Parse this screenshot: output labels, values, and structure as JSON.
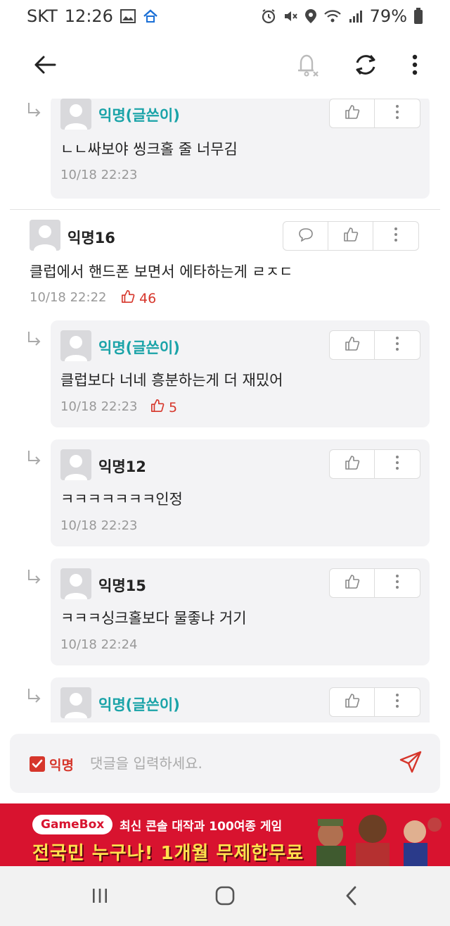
{
  "status_bar": {
    "carrier": "SKT",
    "time": "12:26",
    "battery": "79%"
  },
  "comments": [
    {
      "kind": "reply",
      "author": "익명(글쓴이)",
      "is_op": true,
      "text": "ㄴㄴ싸보야 씽크홀 줄 너무김",
      "time": "10/18 22:23",
      "likes": null
    },
    {
      "kind": "comment",
      "author": "익명16",
      "is_op": false,
      "text": "클럽에서 핸드폰 보면서 에타하는게 ㄹㅈㄷ",
      "time": "10/18 22:22",
      "likes": "46"
    },
    {
      "kind": "reply",
      "author": "익명(글쓴이)",
      "is_op": true,
      "text": "클럽보다 너네 흥분하는게 더 재밌어",
      "time": "10/18 22:23",
      "likes": "5"
    },
    {
      "kind": "reply",
      "author": "익명12",
      "is_op": false,
      "text": "ㅋㅋㅋㅋㅋㅋㅋ인정",
      "time": "10/18 22:23",
      "likes": null
    },
    {
      "kind": "reply",
      "author": "익명15",
      "is_op": false,
      "text": "ㅋㅋㅋ싱크홀보다 물좋냐 거기",
      "time": "10/18 22:24",
      "likes": null
    },
    {
      "kind": "reply",
      "author": "익명(글쓴이)",
      "is_op": true,
      "text": "",
      "time": "",
      "likes": null
    }
  ],
  "input": {
    "anonymous_label": "익명",
    "anonymous_checked": true,
    "placeholder": "댓글을 입력하세요."
  },
  "ad": {
    "logo": "GameBox",
    "line1": "최신 콘솔 대작과 100여종 게임",
    "line2": "전국민 누구나! 1개월 무제한무료"
  },
  "colors": {
    "op_author": "#1aa3a8",
    "like_red": "#d6362b",
    "ad_bg": "#d8132f",
    "card_bg": "#f3f3f5"
  },
  "icons": {
    "back": "arrow-left-icon",
    "bell": "bell-off-icon",
    "refresh": "refresh-icon",
    "more": "more-vertical-icon",
    "reply": "reply-arrow-icon",
    "like": "thumbs-up-icon",
    "message": "speech-bubble-icon",
    "send": "paper-plane-icon"
  }
}
